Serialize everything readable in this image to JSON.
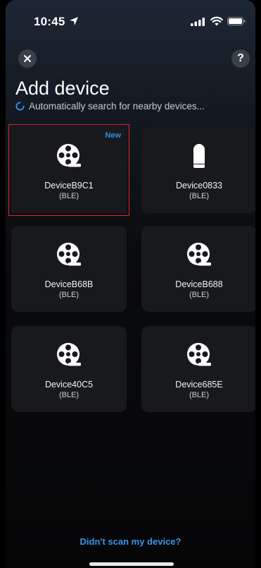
{
  "status_bar": {
    "time": "10:45"
  },
  "header": {
    "close_icon": "close-icon",
    "help_label": "?",
    "title": "Add device",
    "searching_text": "Automatically search for nearby devices..."
  },
  "devices": [
    {
      "name": "DeviceB9C1",
      "protocol": "(BLE)",
      "icon": "film-reel-icon",
      "badge": "New",
      "selected": true
    },
    {
      "name": "Device0833",
      "protocol": "(BLE)",
      "icon": "speaker-icon",
      "badge": "",
      "selected": false
    },
    {
      "name": "DeviceB68B",
      "protocol": "(BLE)",
      "icon": "film-reel-icon",
      "badge": "",
      "selected": false
    },
    {
      "name": "DeviceB688",
      "protocol": "(BLE)",
      "icon": "film-reel-icon",
      "badge": "",
      "selected": false
    },
    {
      "name": "Device40C5",
      "protocol": "(BLE)",
      "icon": "film-reel-icon",
      "badge": "",
      "selected": false
    },
    {
      "name": "Device685E",
      "protocol": "(BLE)",
      "icon": "film-reel-icon",
      "badge": "",
      "selected": false
    }
  ],
  "footer": {
    "link_label": "Didn't scan my device?"
  },
  "colors": {
    "accent": "#3a95e8",
    "selection": "#e02424",
    "card_bg": "#17191d"
  }
}
